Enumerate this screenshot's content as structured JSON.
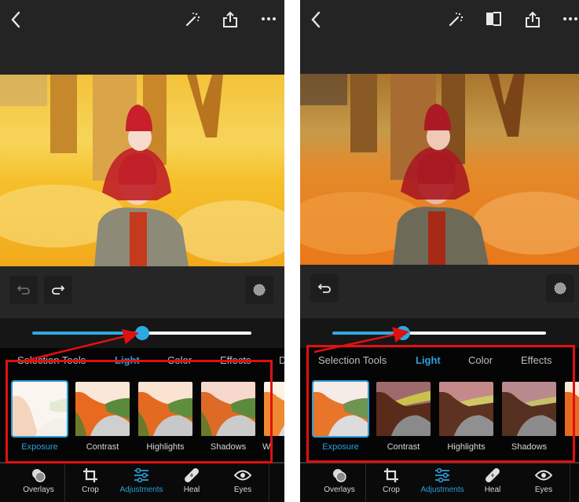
{
  "screens": [
    {
      "id": "before",
      "topbar": {
        "icons": [
          "back-chevron-icon",
          "magic-wand-icon",
          "share-icon",
          "more-dots-icon"
        ]
      },
      "photo": {
        "description": "Mother and child in red knit hats lying in autumn leaves (bright/overexposed)"
      },
      "toolrow": {
        "icons": [
          "undo-icon",
          "redo-icon",
          "brush-size-icon"
        ]
      },
      "slider": {
        "name": "Exposure",
        "value_fraction": 0.53
      },
      "tabs": [
        {
          "label": "Selection Tools",
          "active": false
        },
        {
          "label": "Light",
          "active": true
        },
        {
          "label": "Color",
          "active": false
        },
        {
          "label": "Effects",
          "active": false
        },
        {
          "label": "D",
          "active": false
        }
      ],
      "thumbnails": [
        {
          "label": "Exposure",
          "selected": true
        },
        {
          "label": "Contrast",
          "selected": false
        },
        {
          "label": "Highlights",
          "selected": false
        },
        {
          "label": "Shadows",
          "selected": false
        },
        {
          "label": "W",
          "selected": false
        }
      ],
      "bottom_nav": [
        {
          "label": "Overlays",
          "icon": "overlays-icon",
          "active": false
        },
        {
          "label": "Crop",
          "icon": "crop-icon",
          "active": false
        },
        {
          "label": "Adjustments",
          "icon": "sliders-icon",
          "active": true
        },
        {
          "label": "Heal",
          "icon": "bandage-icon",
          "active": false
        },
        {
          "label": "Eyes",
          "icon": "eye-icon",
          "active": false
        }
      ]
    },
    {
      "id": "after",
      "topbar": {
        "icons": [
          "back-chevron-icon",
          "magic-wand-icon",
          "compare-icon",
          "share-icon",
          "more-dots-icon"
        ]
      },
      "photo": {
        "description": "Mother and child in red knit hats lying in autumn leaves (adjusted, warmer/darker)"
      },
      "toolrow": {
        "icons": [
          "undo-icon",
          "brush-size-icon"
        ]
      },
      "slider": {
        "name": "Exposure",
        "value_fraction": 0.3
      },
      "tabs": [
        {
          "label": "Selection Tools",
          "active": false
        },
        {
          "label": "Light",
          "active": true
        },
        {
          "label": "Color",
          "active": false
        },
        {
          "label": "Effects",
          "active": false
        }
      ],
      "thumbnails": [
        {
          "label": "Exposure",
          "selected": true
        },
        {
          "label": "Contrast",
          "selected": false
        },
        {
          "label": "Highlights",
          "selected": false
        },
        {
          "label": "Shadows",
          "selected": false
        },
        {
          "label": "",
          "selected": false
        }
      ],
      "bottom_nav": [
        {
          "label": "Overlays",
          "icon": "overlays-icon",
          "active": false
        },
        {
          "label": "Crop",
          "icon": "crop-icon",
          "active": false
        },
        {
          "label": "Adjustments",
          "icon": "sliders-icon",
          "active": true
        },
        {
          "label": "Heal",
          "icon": "bandage-icon",
          "active": false
        },
        {
          "label": "Eyes",
          "icon": "eye-icon",
          "active": false
        }
      ]
    }
  ],
  "colors": {
    "accent": "#2c9fd8",
    "annotation": "#e01010",
    "background": "#232323",
    "panel": "#050505"
  }
}
